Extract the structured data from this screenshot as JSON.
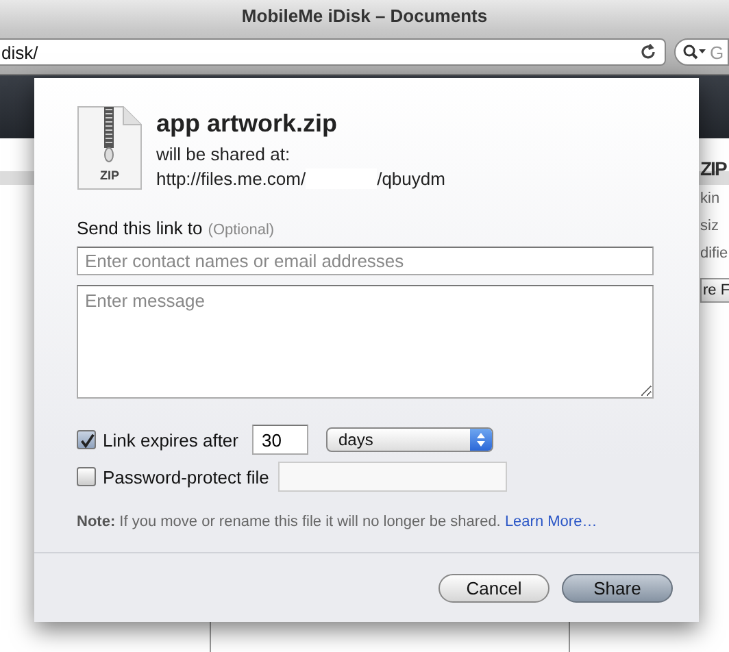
{
  "window": {
    "title": "MobileMe iDisk – Documents"
  },
  "toolbar": {
    "address": "disk/",
    "search_placeholder": "G"
  },
  "background": {
    "preview_label": "ZIP",
    "info_labels": [
      "kin",
      "siz",
      "difie"
    ],
    "button_label": "re F"
  },
  "dialog": {
    "file_name": "app artwork.zip",
    "file_type": "ZIP",
    "subtitle": "will be shared at:",
    "url_start": "http://files.me.com/",
    "url_end": "/qbuydm",
    "send_label": "Send this link to",
    "send_hint": "(Optional)",
    "recipients": {
      "placeholder": "Enter contact names or email addresses"
    },
    "message": {
      "placeholder": "Enter message"
    },
    "expires": {
      "label": "Link expires after",
      "checked": true,
      "value": "30",
      "unit": "days"
    },
    "password": {
      "label": "Password-protect file",
      "checked": false
    },
    "note_label": "Note:",
    "note": "If you move or rename this file it will no longer be shared.",
    "note_link": "Learn More…",
    "buttons": [
      {
        "label": "Cancel",
        "kind": "secondary"
      },
      {
        "label": "Share",
        "kind": "primary"
      }
    ]
  }
}
